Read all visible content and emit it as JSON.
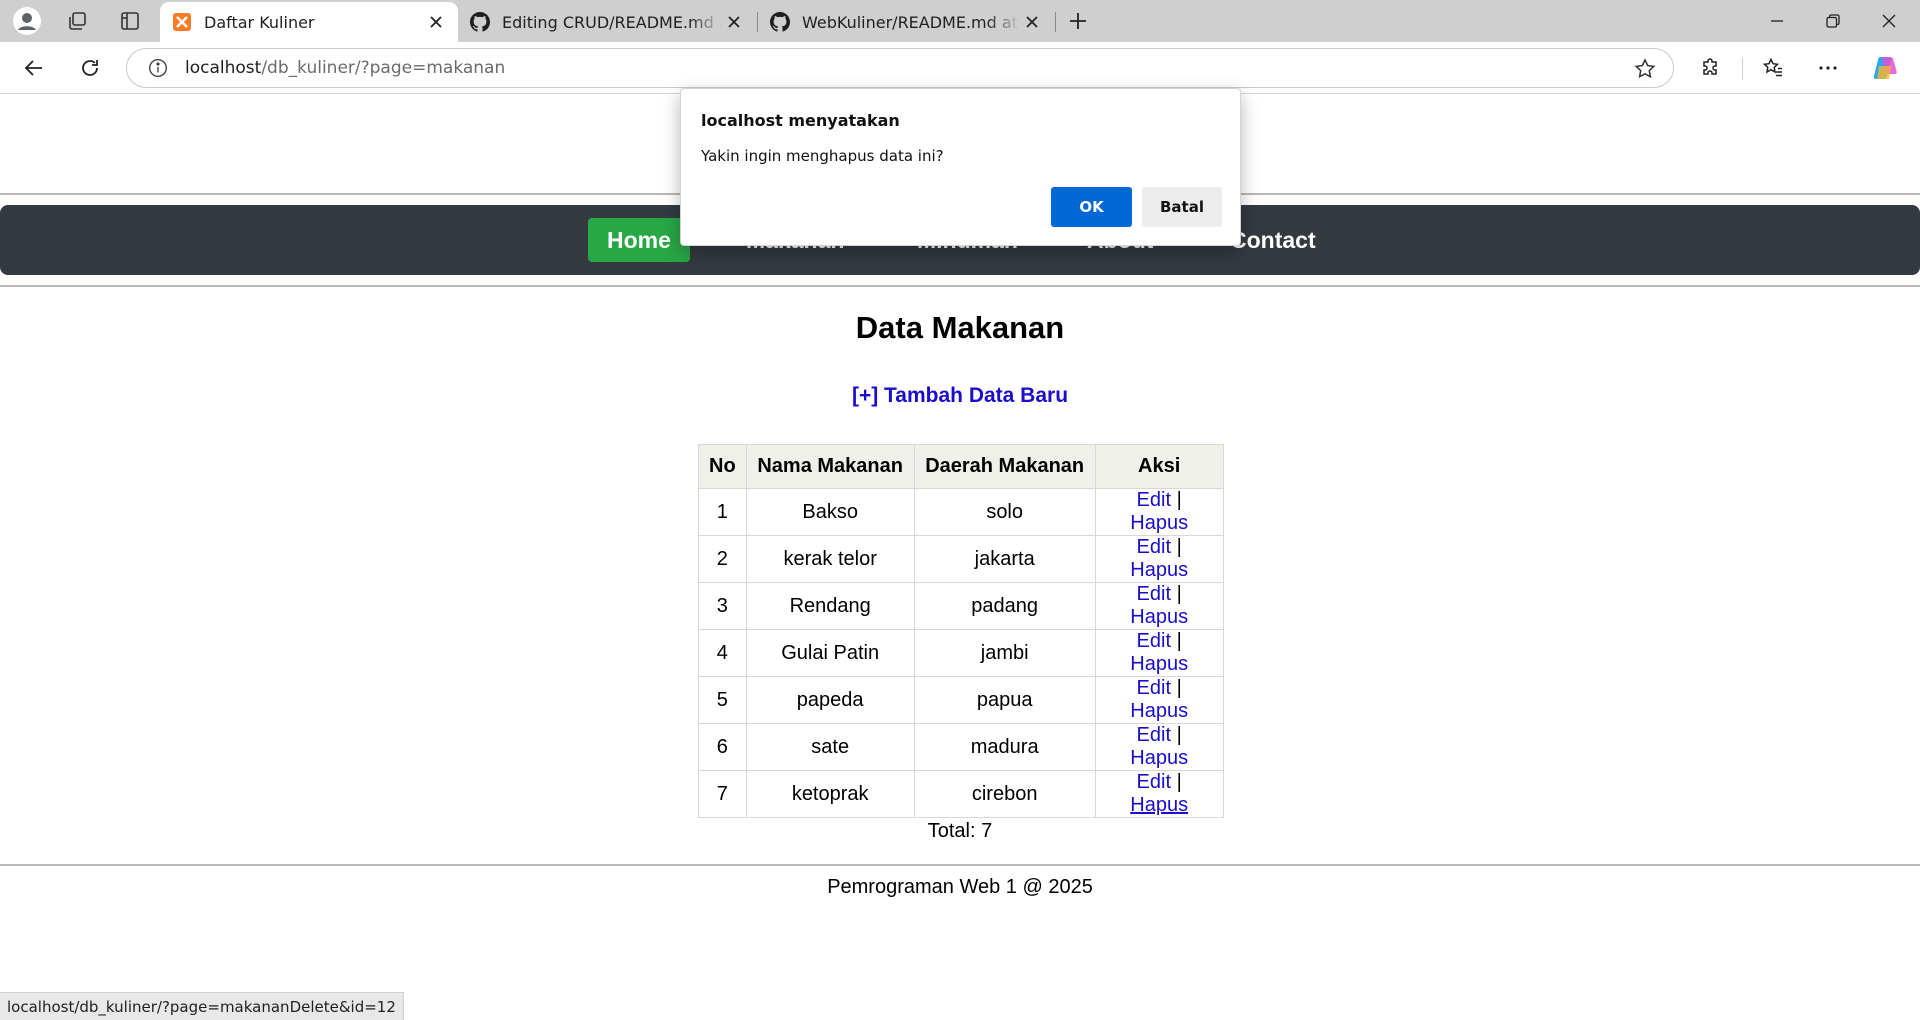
{
  "browser": {
    "tabs": [
      {
        "title": "Daftar Kuliner",
        "active": true,
        "icon": "xampp-icon"
      },
      {
        "title": "Editing CRUD/README.md at main",
        "active": false,
        "icon": "github-icon"
      },
      {
        "title": "WebKuliner/README.md at main",
        "active": false,
        "icon": "github-icon"
      }
    ],
    "url_host": "localhost",
    "url_path": "/db_kuliner/?page=makanan",
    "status_url": "localhost/db_kuliner/?page=makananDelete&id=12"
  },
  "site": {
    "nav": [
      "Home",
      "Makanan",
      "Minuman",
      "About",
      "Contact"
    ],
    "page_title": "Data Makanan",
    "add_link": "[+] Tambah Data Baru",
    "table": {
      "headers": [
        "No",
        "Nama Makanan",
        "Daerah Makanan",
        "Aksi"
      ],
      "rows": [
        {
          "no": "1",
          "nama": "Bakso",
          "daerah": "solo"
        },
        {
          "no": "2",
          "nama": "kerak telor",
          "daerah": "jakarta"
        },
        {
          "no": "3",
          "nama": "Rendang",
          "daerah": "padang"
        },
        {
          "no": "4",
          "nama": "Gulai Patin",
          "daerah": "jambi"
        },
        {
          "no": "5",
          "nama": "papeda",
          "daerah": "papua"
        },
        {
          "no": "6",
          "nama": "sate",
          "daerah": "madura"
        },
        {
          "no": "7",
          "nama": "ketoprak",
          "daerah": "cirebon"
        }
      ],
      "edit_label": "Edit",
      "separator": "|",
      "delete_label": "Hapus"
    },
    "total": "Total: 7",
    "footer": "Pemrograman Web 1 @ 2025"
  },
  "dialog": {
    "title": "localhost menyatakan",
    "message": "Yakin ingin menghapus data ini?",
    "ok_label": "OK",
    "cancel_label": "Batal"
  },
  "colors": {
    "nav_bg": "#343a40",
    "home_bg": "#28a745",
    "link": "#1a0dcc",
    "ok_button": "#0067d6"
  }
}
